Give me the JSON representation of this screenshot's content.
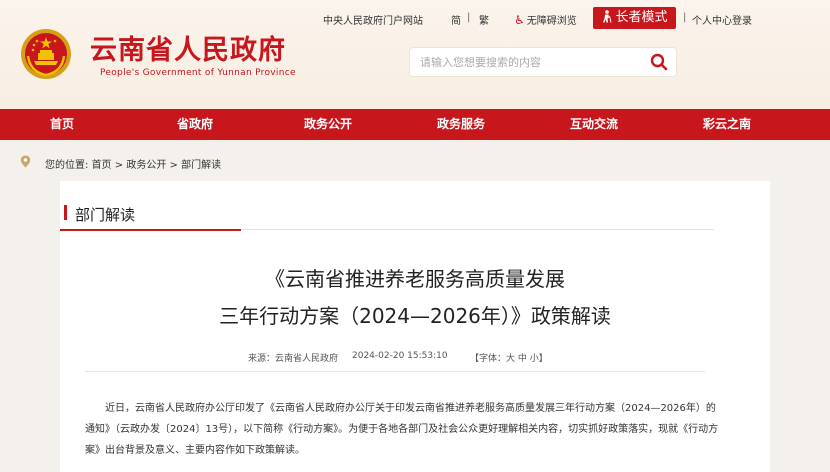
{
  "header": {
    "site_title": "云南省人民政府",
    "site_subtitle": "People's Government of Yunnan Province",
    "portal_link": "中央人民政府门户网站",
    "lang_simplified": "简",
    "lang_separator": "|",
    "lang_traditional": "繁",
    "accessibility_label": "无障碍浏览",
    "elder_mode_label": "长者模式",
    "separator": "|",
    "user_center_label": "个人中心登录"
  },
  "search": {
    "placeholder": "请输入您想要搜索的内容"
  },
  "nav": {
    "items": [
      "首页",
      "省政府",
      "政务公开",
      "政务服务",
      "互动交流",
      "彩云之南"
    ]
  },
  "breadcrumb": {
    "prefix": "您的位置:",
    "items": [
      "首页",
      "政务公开",
      "部门解读"
    ],
    "sep": ">"
  },
  "section": {
    "title": "部门解读"
  },
  "article": {
    "title_line1": "《云南省推进养老服务高质量发展",
    "title_line2": "三年行动方案（2024—2026年）》政策解读",
    "source": "来源：云南省人民政府",
    "datetime": "2024-02-20 15:53:10",
    "font_label": "【字体：大 中 小】",
    "body_paragraph": "近日，云南省人民政府办公厅印发了《云南省人民政府办公厅关于印发云南省推进养老服务高质量发展三年行动方案（2024—2026年）的通知》（云政办发〔2024〕13号），以下简称《行动方案》。为便于各地各部门及社会公众更好理解相关内容，切实抓好政策落实，现就《行动方案》出台背景及意义、主要内容作如下政策解读。"
  },
  "colors": {
    "brand_red": "#c8161d",
    "header_bg": "#f7ede2",
    "page_bg": "#f4f1ec"
  }
}
